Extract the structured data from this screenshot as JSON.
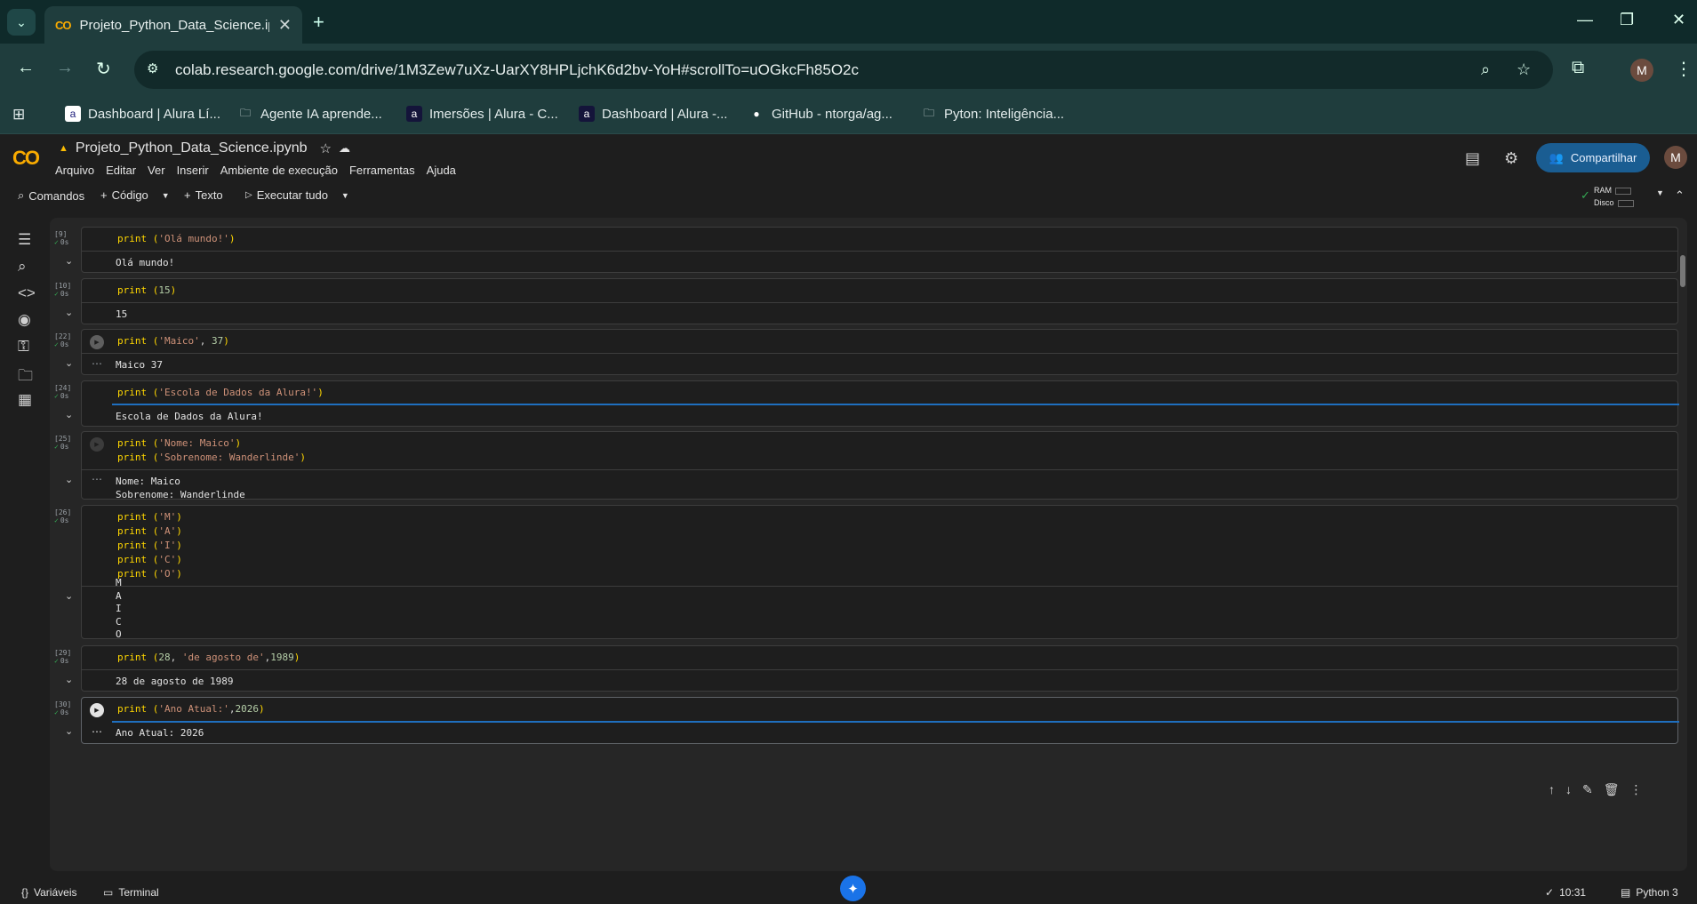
{
  "browser": {
    "tab_title": "Projeto_Python_Data_Science.ip",
    "url": "colab.research.google.com/drive/1M3Zew7uXz-UarXY8HPLjchK6d2bv-YoH#scrollTo=uOGkcFh85O2c",
    "profile_initial": "M",
    "bookmarks": [
      {
        "label": "Dashboard | Alura Lí..."
      },
      {
        "label": "Agente IA aprende..."
      },
      {
        "label": "Imersões | Alura - C..."
      },
      {
        "label": "Dashboard | Alura -..."
      },
      {
        "label": "GitHub - ntorga/ag..."
      },
      {
        "label": "Pyton: Inteligência..."
      }
    ]
  },
  "colab": {
    "logo": "CO",
    "notebook_title": "Projeto_Python_Data_Science.ipynb",
    "menu": [
      "Arquivo",
      "Editar",
      "Ver",
      "Inserir",
      "Ambiente de execução",
      "Ferramentas",
      "Ajuda"
    ],
    "share_label": "Compartilhar",
    "user_initial": "M",
    "toolbar": {
      "commands": "Comandos",
      "code": "Código",
      "text": "Texto",
      "run_all": "Executar tudo",
      "ram": "RAM",
      "disk": "Disco"
    }
  },
  "cells": [
    {
      "num": "[9]",
      "time": "0s",
      "code": [
        "print ('Olá mundo!')"
      ],
      "output": "Olá mundo!"
    },
    {
      "num": "[10]",
      "time": "0s",
      "code": [
        "print (15)"
      ],
      "output": "15"
    },
    {
      "num": "[22]",
      "time": "0s",
      "code": [
        "print ('Maico', 37)"
      ],
      "output": "Maico 37"
    },
    {
      "num": "[24]",
      "time": "0s",
      "code": [
        "print ('Escola de Dados da Alura!')"
      ],
      "output": "Escola de Dados da Alura!"
    },
    {
      "num": "[25]",
      "time": "0s",
      "code": [
        "print ('Nome: Maico')",
        "print ('Sobrenome: Wanderlinde')"
      ],
      "output": "Nome: Maico\nSobrenome: Wanderlinde"
    },
    {
      "num": "[26]",
      "time": "0s",
      "code": [
        "print ('M')",
        "print ('A')",
        "print ('I')",
        "print ('C')",
        "print ('O')"
      ],
      "output": "M\nA\nI\nC\nO"
    },
    {
      "num": "[29]",
      "time": "0s",
      "code": [
        "print (28, 'de agosto de',1989)"
      ],
      "output": "28 de agosto de 1989"
    },
    {
      "num": "[30]",
      "time": "0s",
      "code": [
        "print ('Ano Atual:',2026)"
      ],
      "output": "Ano Atual: 2026"
    }
  ],
  "status": {
    "variables": "Variáveis",
    "terminal": "Terminal",
    "time": "10:31",
    "runtime": "Python 3"
  },
  "colors": {
    "accent": "#1a5d92",
    "ok": "#34a853",
    "string": "#ce9178",
    "number": "#b5cea8"
  }
}
